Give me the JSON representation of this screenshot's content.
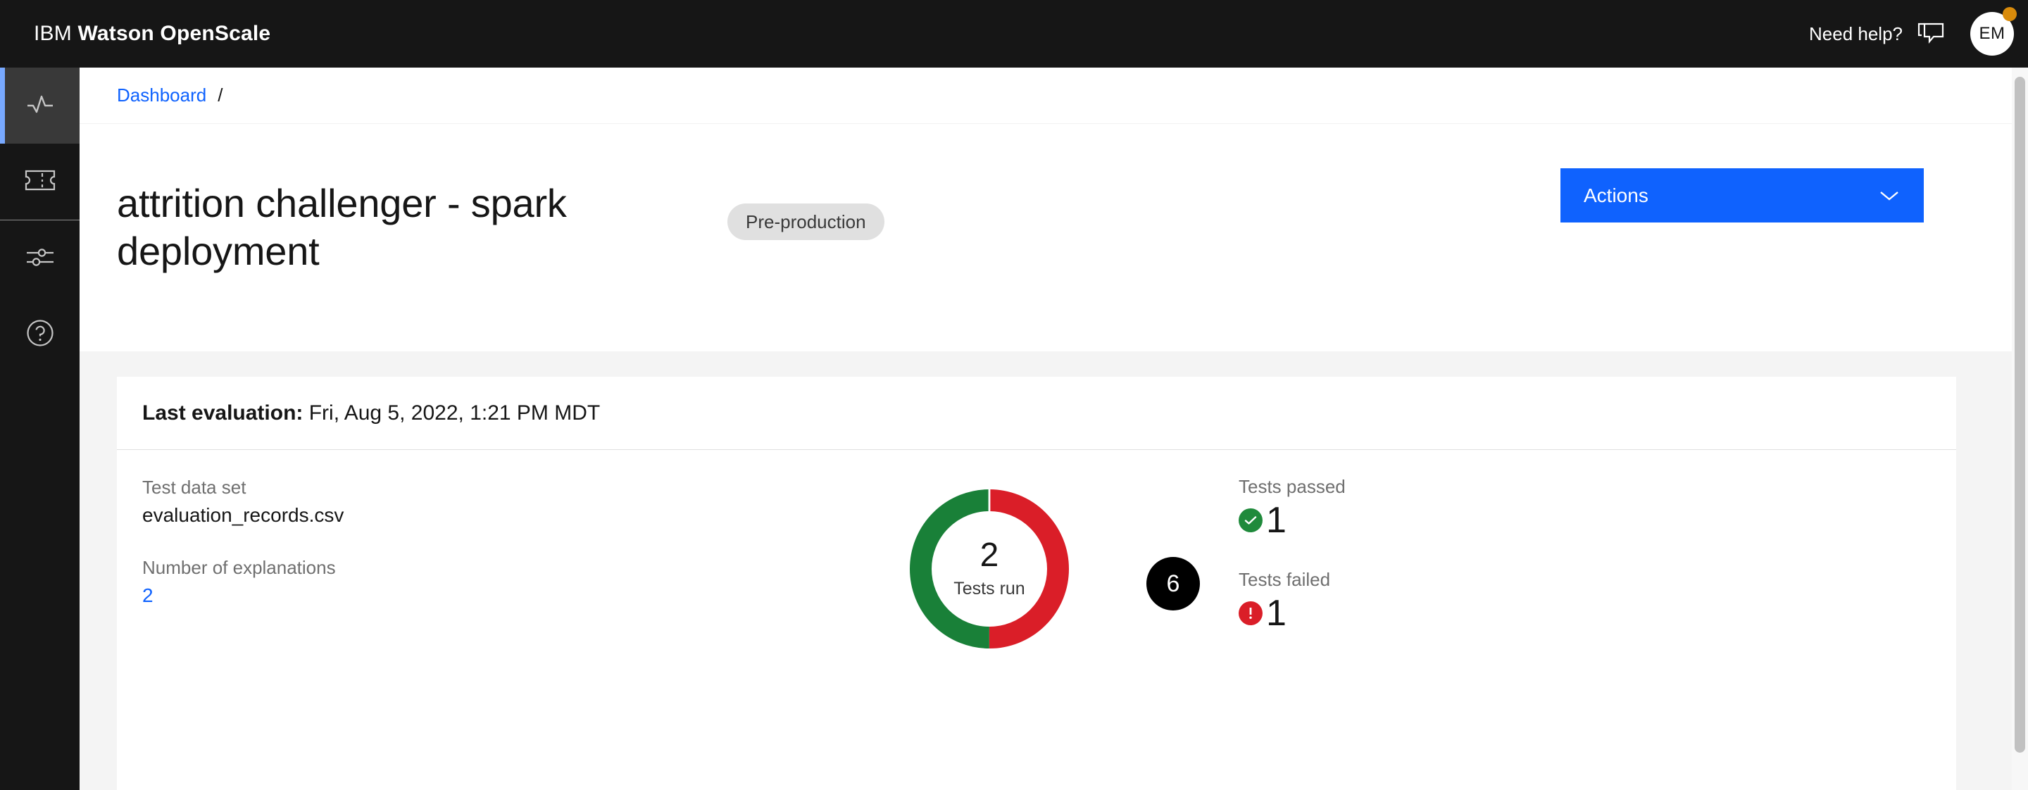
{
  "header": {
    "brand_prefix": "IBM ",
    "brand_name": "Watson OpenScale",
    "need_help": "Need help?",
    "chat_icon": "chat-bubble-icon",
    "avatar_initials": "EM",
    "notification_dot_color": "#d98b0b"
  },
  "rail": {
    "items": [
      {
        "name": "sidebar-item-monitor",
        "icon": "activity-pulse-icon",
        "active": true
      },
      {
        "name": "sidebar-item-tickets",
        "icon": "ticket-icon",
        "active": false
      },
      {
        "name": "sidebar-item-settings",
        "icon": "sliders-icon",
        "active": false
      },
      {
        "name": "sidebar-item-help",
        "icon": "help-circle-icon",
        "active": false
      }
    ]
  },
  "breadcrumb": {
    "link": "Dashboard",
    "separator": "/"
  },
  "title_section": {
    "title": "attrition challenger - spark deployment",
    "tag": "Pre-production",
    "actions_label": "Actions",
    "chevron_icon": "chevron-down-icon",
    "accent_color": "#0f62fe"
  },
  "summary": {
    "last_evaluation_label": "Last evaluation:",
    "last_evaluation_value": " Fri, Aug 5, 2022, 1:21 PM MDT",
    "test_data_set_label": "Test data set",
    "test_data_set_value": "evaluation_records.csv",
    "explanations_label": "Number of explanations",
    "explanations_value": "2",
    "badge_count": "6",
    "tests_passed_label": "Tests passed",
    "tests_passed_value": "1",
    "tests_passed_icon": "checkmark-filled-icon",
    "tests_failed_label": "Tests failed",
    "tests_failed_value": "1",
    "tests_failed_icon": "error-filled-icon",
    "pass_color": "#1f8a3b",
    "fail_color": "#da1e28"
  },
  "chart_data": {
    "type": "pie",
    "title": "Tests run",
    "center_value": "2",
    "center_label": "Tests run",
    "categories": [
      "Tests passed",
      "Tests failed"
    ],
    "values": [
      1,
      1
    ],
    "colors": [
      "#198038",
      "#da1e28"
    ],
    "legend": "none",
    "donut": true
  }
}
